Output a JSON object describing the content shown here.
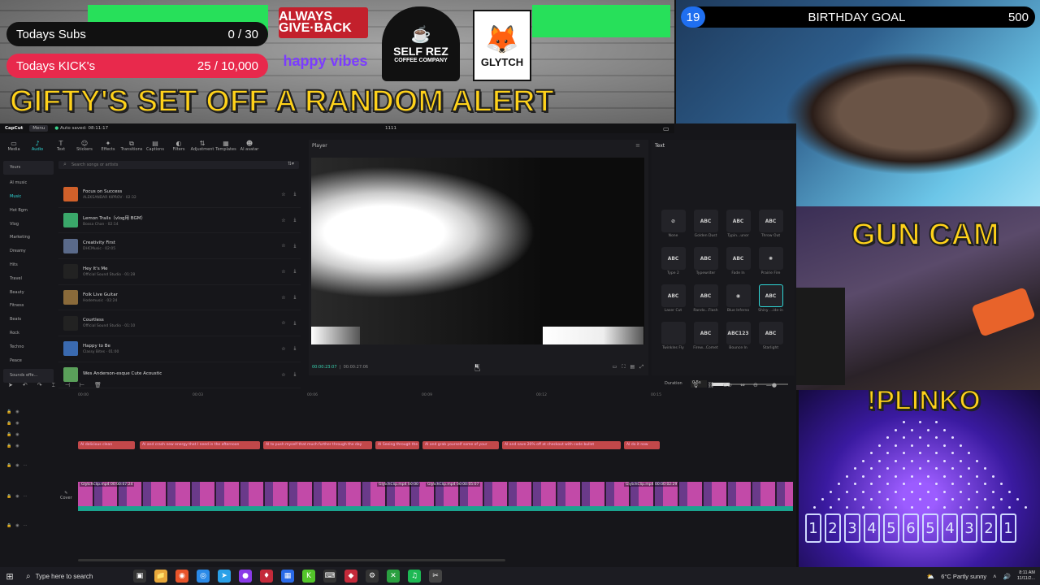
{
  "overlay": {
    "subs_goal": {
      "label": "Todays Subs",
      "value": "0 / 30"
    },
    "kick_goal": {
      "label": "Todays KICK's",
      "value": "25 / 10,000"
    },
    "sponsors": {
      "always": "ALWAYS GIVE·BACK",
      "happy": "happy vibes",
      "selfrez": "SELF REZ",
      "selfrez_sub": "COFFEE COMPANY",
      "glytch": "GLYTCH"
    },
    "banner": "GIFTY'S SET OFF A RANDOM ALERT",
    "accent_green": "#27e05a",
    "accent_red": "#e8294c",
    "accent_yellow": "#ffd21a"
  },
  "webcam": {
    "birthday_count": "19",
    "birthday_label": "BIRTHDAY GOAL",
    "birthday_target": "500",
    "gun_cam_title": "GUN CAM",
    "plinko_title": "!PLINKO",
    "plinko_slots": [
      "1",
      "2",
      "3",
      "4",
      "5",
      "6",
      "5",
      "4",
      "3",
      "2",
      "1"
    ]
  },
  "editor": {
    "titlebar": {
      "logo": "CapCut",
      "menu": "Menu",
      "saved": "Auto saved: 08:11:17",
      "center": "1111"
    },
    "tool_tabs": [
      {
        "icon": "▭",
        "label": "Media"
      },
      {
        "icon": "♪",
        "label": "Audio"
      },
      {
        "icon": "T",
        "label": "Text"
      },
      {
        "icon": "☺",
        "label": "Stickers"
      },
      {
        "icon": "✦",
        "label": "Effects"
      },
      {
        "icon": "⧉",
        "label": "Transitions"
      },
      {
        "icon": "▤",
        "label": "Captions"
      },
      {
        "icon": "◐",
        "label": "Filters"
      },
      {
        "icon": "⇅",
        "label": "Adjustment"
      },
      {
        "icon": "▦",
        "label": "Templates"
      },
      {
        "icon": "☻",
        "label": "AI avatar"
      }
    ],
    "categories": [
      "Yours",
      "AI music",
      "Music",
      "Hot Bgm",
      "Vlog",
      "Marketing",
      "Dreamy",
      "Hits",
      "Travel",
      "Beauty",
      "Fitness",
      "Beats",
      "Rock",
      "Techno",
      "Peace",
      "Sounds effe..."
    ],
    "search_placeholder": "Search songs or artists",
    "tracks": [
      {
        "name": "Focus on Success",
        "artist": "ALEKSANDAR KIPROV · 02:32",
        "color": "#d0602a"
      },
      {
        "name": "Lemon Trails（vlog用 BGM）",
        "artist": "Bossa Chan · 02:14",
        "color": "#3aa86a"
      },
      {
        "name": "Creativity First",
        "artist": "DHCMusic · 02:05",
        "color": "#5a6a8a"
      },
      {
        "name": "Hey It's Me",
        "artist": "Official Sound Studio · 01:28",
        "color": "#222"
      },
      {
        "name": "Folk Live Guitar",
        "artist": "Hodemusic · 02:24",
        "color": "#8a6a3a"
      },
      {
        "name": "Courtless",
        "artist": "Official Sound Studio · 01:10",
        "color": "#222"
      },
      {
        "name": "Happy to Be",
        "artist": "Classy Bites · 01:00",
        "color": "#3a6ab0"
      },
      {
        "name": "Wes Anderson-esque Cute Acoustic",
        "artist": "",
        "color": "#5aa05a"
      }
    ],
    "player": {
      "label": "Player",
      "current_time": "00:00:23:07",
      "total_time": "00:00:27:06"
    },
    "text_panel": {
      "label": "Text",
      "animations": [
        {
          "thumb": "⊘",
          "name": "None"
        },
        {
          "thumb": "ABC",
          "name": "Golden Dust"
        },
        {
          "thumb": "ABC",
          "name": "Typin...unor"
        },
        {
          "thumb": "ABC",
          "name": "Throw Out"
        },
        {
          "thumb": "ABC",
          "name": "Type 2"
        },
        {
          "thumb": "ABC",
          "name": "Typewriter"
        },
        {
          "thumb": "ABC",
          "name": "Fade In"
        },
        {
          "thumb": "✺",
          "name": "Prairie Fire"
        },
        {
          "thumb": "ABC",
          "name": "Laser Cut"
        },
        {
          "thumb": "ABC",
          "name": "Rando...Flash"
        },
        {
          "thumb": "◉",
          "name": "Blue Inferno"
        },
        {
          "thumb": "ABC",
          "name": "Shiny ...ide-in"
        },
        {
          "thumb": "",
          "name": "Twinkles Fly"
        },
        {
          "thumb": "ABC",
          "name": "Firew...Comet"
        },
        {
          "thumb": "ABC123",
          "name": "Bounce In"
        },
        {
          "thumb": "ABC",
          "name": "Starlight"
        }
      ],
      "duration_label": "Duration",
      "duration_value": "0.5s"
    },
    "ruler_ticks": [
      "00:00",
      "00:03",
      "00:06",
      "00:09",
      "00:12",
      "00:15"
    ],
    "captions": [
      {
        "text": "AI delicious clean"
      },
      {
        "text": "AI and crash new energy that I need in the afternoon"
      },
      {
        "text": "AI to push myself that much further through the day"
      },
      {
        "text": "AI Seeing through the"
      },
      {
        "text": "AI and grab yourself some of your"
      },
      {
        "text": "AI and save 20% off at checkout with code bullet"
      },
      {
        "text": "AI do it now"
      }
    ],
    "video_segments": [
      {
        "label": "GlytchClip.mp4  00:00:07:24"
      },
      {
        "label": "GlytchClip.mp4  00:00"
      },
      {
        "label": "GlytchClip.mp4  00:00:05:07"
      },
      {
        "label": "GlytchClip.mp4  00:00:02:29"
      }
    ],
    "cover_label": "Cover"
  },
  "taskbar": {
    "search_placeholder": "Type here to search",
    "weather": "6°C  Partly sunny",
    "time": "8:11 AM",
    "date": "11/11/2..."
  }
}
